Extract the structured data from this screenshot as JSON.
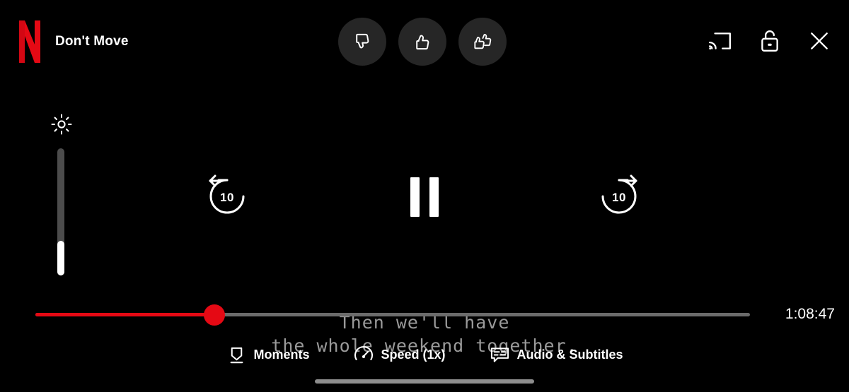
{
  "app": {
    "name": "Netflix",
    "logo_icon": "netflix-n-logo",
    "brand_color": "#e50914"
  },
  "header": {
    "title": "Don't Move",
    "rating_buttons": [
      {
        "id": "thumbs-down",
        "icon": "thumbs-down-icon",
        "label": "Not for me"
      },
      {
        "id": "thumbs-up",
        "icon": "thumbs-up-icon",
        "label": "I like this"
      },
      {
        "id": "two-thumbs-up",
        "icon": "two-thumbs-up-icon",
        "label": "Love this"
      }
    ],
    "right_icons": [
      {
        "id": "cast",
        "icon": "cast-icon",
        "label": "Cast"
      },
      {
        "id": "lock",
        "icon": "unlock-icon",
        "label": "Lock screen"
      },
      {
        "id": "close",
        "icon": "close-icon",
        "label": "Close"
      }
    ]
  },
  "brightness": {
    "icon": "brightness-sun-icon",
    "value_percent": 27,
    "track_color": "#4c4c4c",
    "fill_color": "#ffffff"
  },
  "transport": {
    "rewind": {
      "icon": "rewind-10-icon",
      "seconds": "10",
      "label": "Rewind 10 seconds"
    },
    "play_pause": {
      "icon": "pause-icon",
      "state": "playing",
      "label": "Pause"
    },
    "forward": {
      "icon": "forward-10-icon",
      "seconds": "10",
      "label": "Forward 10 seconds"
    }
  },
  "subtitles": {
    "line1": "Then we'll have",
    "line2": "the whole weekend together.",
    "color": "#9a9a9a"
  },
  "progress": {
    "percent": 25,
    "time_remaining": "1:08:47",
    "fill_color": "#e50914",
    "track_color": "#6b6b6b"
  },
  "bottom_toolbar": {
    "items": [
      {
        "id": "moments",
        "icon": "moments-bookmark-icon",
        "label": "Moments"
      },
      {
        "id": "speed",
        "icon": "speedometer-icon",
        "label": "Speed (1x)"
      },
      {
        "id": "audio-subtitles",
        "icon": "subtitles-bubble-icon",
        "label": "Audio & Subtitles"
      }
    ]
  },
  "system": {
    "home_indicator": "home-indicator-bar"
  }
}
